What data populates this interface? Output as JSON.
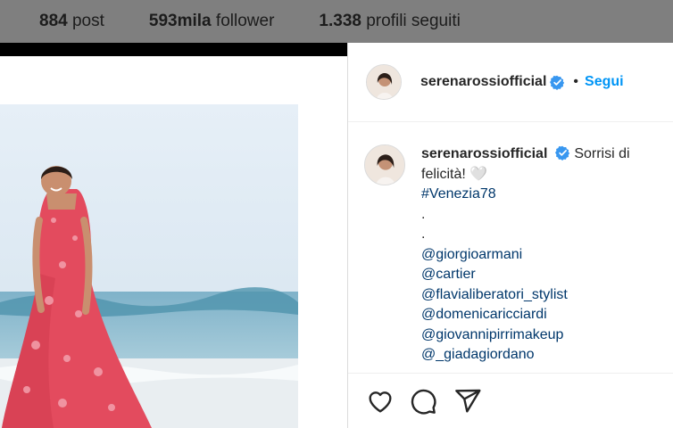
{
  "profile_stats": {
    "posts_count": "884",
    "posts_label": "post",
    "followers_count": "593mila",
    "followers_label": "follower",
    "following_count": "1.338",
    "following_label": "profili seguiti"
  },
  "post": {
    "username": "serenarossiofficial",
    "separator": "•",
    "follow_label": "Segui",
    "caption": {
      "username": "serenarossiofficial",
      "text": "Sorrisi di felicità! 🤍",
      "hashtag": "#Venezia78",
      "dots": [
        ".",
        "."
      ],
      "mentions": [
        "@giorgioarmani",
        "@cartier",
        "@flavialiberatori_stylist",
        "@domenicaricciardi",
        "@giovannipirrimakeup",
        "@_giadagiordano"
      ]
    }
  },
  "icons": {
    "verified": "verified-badge-icon",
    "like": "heart-icon",
    "comment": "comment-bubble-icon",
    "share": "paper-plane-icon"
  },
  "colors": {
    "link_blue": "#0095f6",
    "tag_blue": "#00376b",
    "verified_blue": "#3897f0",
    "overlay_gray": "#7f7f7f"
  }
}
